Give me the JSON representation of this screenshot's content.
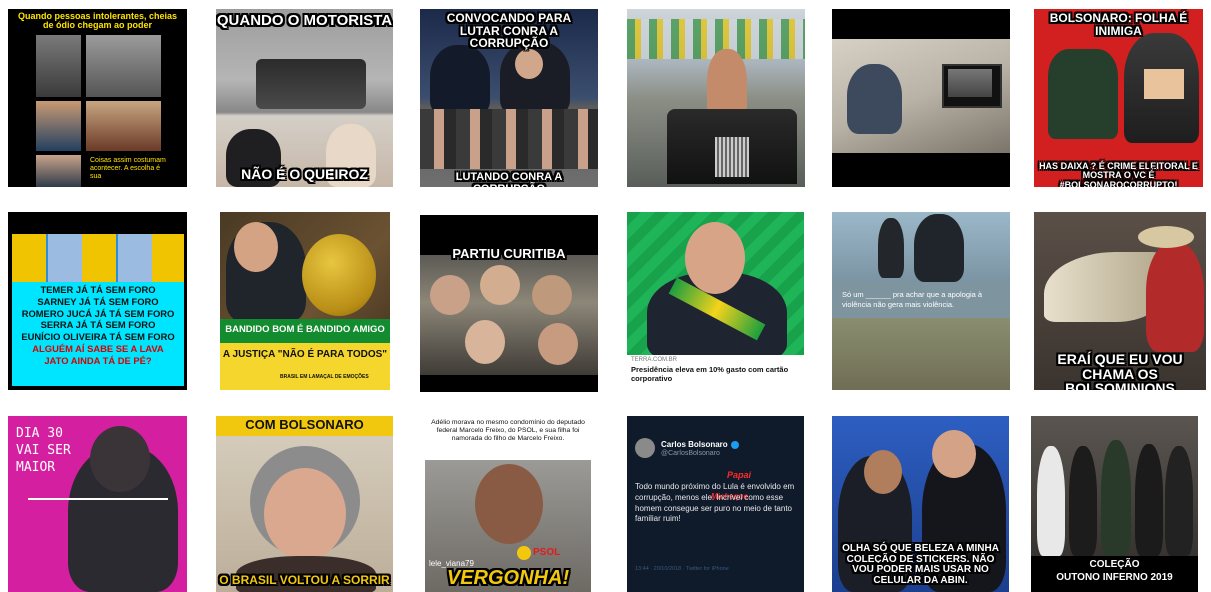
{
  "tiles": {
    "t1": {
      "top": "Quando pessoas intolerantes, cheias de ódio chegam ao poder",
      "bottom": "Coisas assim costumam acontecer. A escolha é sua"
    },
    "t2": {
      "top": "QUANDO O MOTORISTA",
      "bottom": "NÃO É O QUEIROZ"
    },
    "t3": {
      "top": "CONVOCANDO PARA LUTAR CONRA A CORRUPÇÃO",
      "bottom": "LUTANDO CONRA A CORRUPÇÃO"
    },
    "t6": {
      "top": "BOLSONARO: FOLHA É INIMIGA",
      "bottom": "HAS DAIXA ? É CRIME ELEITORAL E MOSTRA O VC É #BOLSONAROCORRUPTO!"
    },
    "t7": {
      "lines": [
        "TEMER JÁ TÁ SEM FORO",
        "SARNEY JÁ TÁ SEM FORO",
        "ROMERO JUCÁ JÁ TÁ SEM FORO",
        "SERRA JÁ TÁ SEM FORO",
        "EUNÍCIO OLIVEIRA TÁ SEM FORO"
      ],
      "question": "ALGUÉM AÍ SABE SE A LAVA JATO AINDA TÁ DE PÉ?"
    },
    "t8": {
      "line1": "BANDIDO BOM É BANDIDO AMIGO",
      "line2": "A JUSTIÇA \"NÃO É PARA TODOS\"",
      "credit": "BRASIL EM LAMAÇAL DE EMOÇÕES"
    },
    "t9": {
      "top": "PARTIU CURITIBA"
    },
    "t10": {
      "source": "TERRA.COM.BR",
      "headline": "Presidência eleva em 10% gasto com cartão corporativo"
    },
    "t11": {
      "text": "Só um ______ pra achar que a apologia à violência não gera mais violência."
    },
    "t12": {
      "bottom": "ERAÍ QUE EU VOU CHAMA OS BOLSOMINIONS"
    },
    "t13": {
      "hand1": "DIA 30",
      "hand2": "VAI SER",
      "hand3": "MAIOR"
    },
    "t14": {
      "top": "COM BOLSONARO",
      "bottom": "O BRASIL VOLTOU A SORRIR"
    },
    "t15": {
      "text": "Adélio morava no mesmo condomínio do deputado federal Marcelo Freixo, do PSOL, e sua filha foi namorada do filho de Marcelo Freixo.",
      "watermark": "lele_viana79",
      "party": "PSOL",
      "bottom": "VERGONHA!"
    },
    "t16": {
      "name": "Carlos Bolsonaro",
      "handle": "@CarlosBolsonaro",
      "tweet": "Todo mundo próximo do Lula é envolvido em corrupção, menos ele. Incrível como esse homem consegue ser puro no meio de tanto familiar ruim!",
      "scribble1": "Papai",
      "scribble2": "Micheque",
      "meta": "13:44 · 20/10/2018 · Twitter for iPhone"
    },
    "t17": {
      "bottom": "OLHA SÓ QUE BELEZA A MINHA COLEÇÃO DE STICKERS. NÃO VOU PODER MAIS USAR NO CELULAR DA ABIN."
    },
    "t18": {
      "line1": "COLEÇÃO",
      "line2": "OUTONO INFERNO 2019"
    }
  }
}
